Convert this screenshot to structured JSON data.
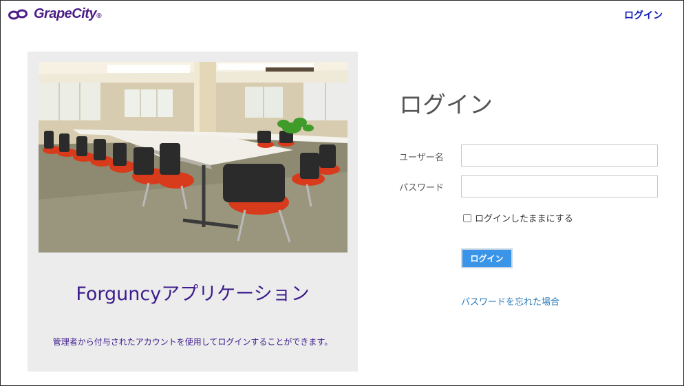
{
  "header": {
    "brand_name": "GrapeCity",
    "brand_mark_symbol": "®",
    "login_link": "ログイン"
  },
  "left_panel": {
    "photo_alt": "conference-room-photo",
    "app_title": "Forguncyアプリケーション",
    "description": "管理者から付与されたアカウントを使用してログインすることができます。"
  },
  "form": {
    "title": "ログイン",
    "username_label": "ユーザー名",
    "username_value": "",
    "password_label": "パスワード",
    "password_value": "",
    "remember_label": "ログインしたままにする",
    "remember_checked": false,
    "submit_label": "ログイン",
    "forgot_link": "パスワードを忘れた場合"
  },
  "colors": {
    "brand_purple": "#4b1d87",
    "header_link": "#0a1bb5",
    "button_blue": "#3a95e8",
    "forgot_link": "#2a7ab8",
    "panel_gray": "#ececec"
  },
  "icons": {
    "brand_mark": "grapecity-logo-icon"
  }
}
